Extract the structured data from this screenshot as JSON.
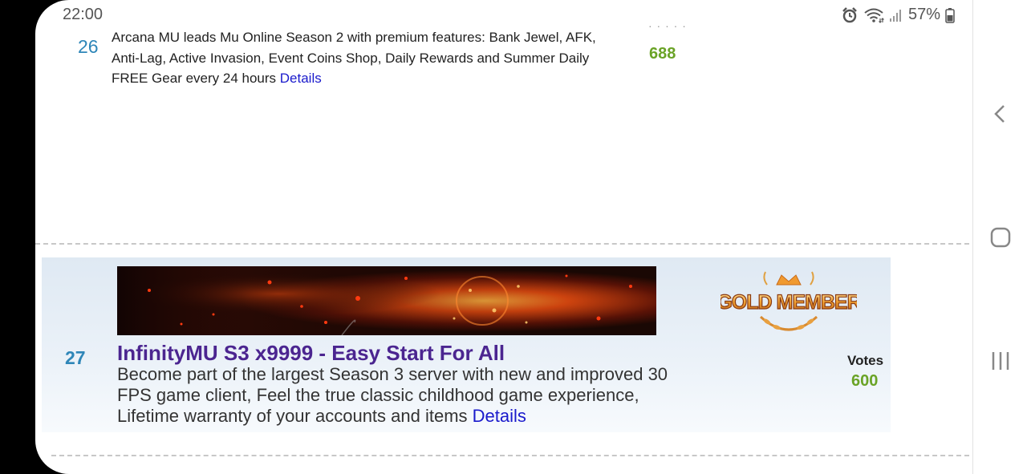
{
  "status_bar": {
    "time": "22:00",
    "battery": "57%"
  },
  "listings": [
    {
      "rank": "26",
      "description": "Arcana MU leads Mu Online Season 2 with premium features: Bank Jewel, AFK, Anti-Lag, Active Invasion, Event Coins Shop, Daily Rewards and Summer Daily FREE Gear every 24 hours",
      "details_label": "Details",
      "votes": "688"
    },
    {
      "rank": "27",
      "title": "InfinityMU S3 x9999 - Easy Start For All",
      "description": "Become part of the largest Season 3 server with new and improved 30 FPS game client, Feel the true classic childhood game experience, Lifetime warranty of your accounts and items",
      "details_label": "Details",
      "votes_label": "Votes",
      "votes": "600",
      "badge": "GOLD MEMBER"
    }
  ],
  "colors": {
    "rank": "#2e86b8",
    "votes": "#6aa326",
    "title": "#4b2590",
    "link": "#1a1acc"
  },
  "nav": {
    "back": "back-icon",
    "home": "home-icon",
    "recents": "recents-icon"
  }
}
